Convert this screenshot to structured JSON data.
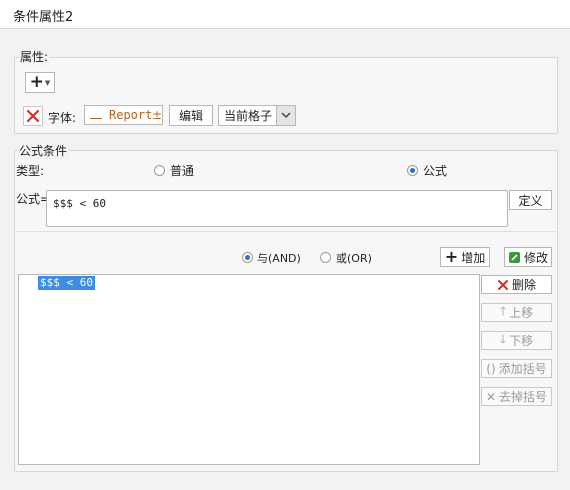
{
  "window": {
    "title": "条件属性2"
  },
  "properties": {
    "group_label": "属性:",
    "font_label": "字体:",
    "font_preview": "Report",
    "edit_label": "编辑",
    "scope_value": "当前格子"
  },
  "formula_condition": {
    "group_label": "公式条件",
    "type_label": "类型:",
    "type_normal": "普通",
    "type_formula": "公式",
    "selected_type": "公式",
    "formula_label": "公式=",
    "formula_value": "$$$ < 60",
    "define_label": "定义",
    "logic_and": "与(AND)",
    "logic_or": "或(OR)",
    "selected_logic": "与(AND)",
    "add_label": "增加",
    "modify_label": "修改",
    "conditions": [
      "$$$ < 60"
    ],
    "delete_label": "删除",
    "move_up_label": "上移",
    "move_down_label": "下移",
    "add_bracket_label": "添加括号",
    "remove_bracket_label": "去掉括号"
  },
  "colors": {
    "accent": "#2f6fc2",
    "delete_red": "#d32f2f",
    "modify_green": "#3a9a3a"
  }
}
